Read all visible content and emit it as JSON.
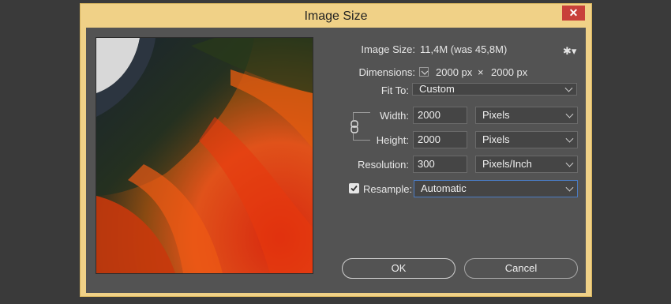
{
  "dialog": {
    "title": "Image Size",
    "close_icon": "close-icon"
  },
  "image_size": {
    "label": "Image Size:",
    "value": "11,4M (was 45,8M)",
    "settings_icon": "gear-icon"
  },
  "dimensions": {
    "label": "Dimensions:",
    "width_value": "2000 px",
    "separator": "×",
    "height_value": "2000 px",
    "dropdown_icon": "chevron-down-icon"
  },
  "fit_to": {
    "label": "Fit To:",
    "selected": "Custom"
  },
  "width": {
    "label": "Width:",
    "value": "2000",
    "unit": "Pixels"
  },
  "height": {
    "label": "Height:",
    "value": "2000",
    "unit": "Pixels"
  },
  "link_icon": "chain-link-icon",
  "resolution": {
    "label": "Resolution:",
    "value": "300",
    "unit": "Pixels/Inch"
  },
  "resample": {
    "label": "Resample:",
    "checked": true,
    "selected": "Automatic"
  },
  "buttons": {
    "ok": "OK",
    "cancel": "Cancel"
  },
  "colors": {
    "title_bar": "#f0d187",
    "client_bg": "#535353",
    "close_button": "#c8403a",
    "active_border": "#4b7cc4"
  }
}
